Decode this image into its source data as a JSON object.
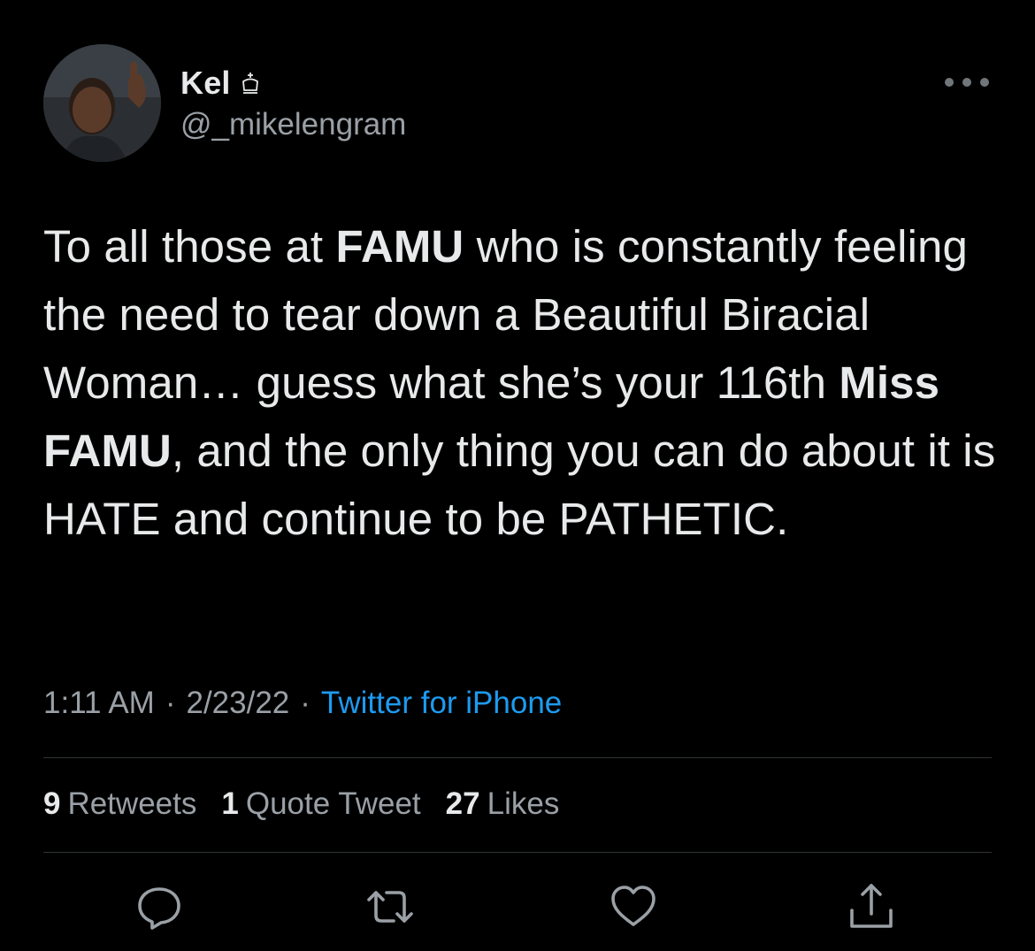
{
  "author": {
    "display_name": "Kel",
    "badge_icon": "crown-icon",
    "handle": "@_mikelengram"
  },
  "tweet": {
    "segments": [
      {
        "text": "To all those at ",
        "bold": false
      },
      {
        "text": "FAMU",
        "bold": true
      },
      {
        "text": " who is constantly feeling the need to tear down a Beautiful Biracial Woman… guess what she’s your 116th ",
        "bold": false
      },
      {
        "text": "Miss FAMU",
        "bold": true
      },
      {
        "text": ", and the only thing you can do about it is HATE and continue to be PATHETIC.",
        "bold": false
      }
    ]
  },
  "meta": {
    "time": "1:11 AM",
    "separator": "·",
    "date": "2/23/22",
    "source": "Twitter for iPhone"
  },
  "stats": {
    "retweets_count": "9",
    "retweets_label": "Retweets",
    "quotes_count": "1",
    "quotes_label": "Quote Tweet",
    "likes_count": "27",
    "likes_label": "Likes"
  },
  "actions": {
    "reply_icon": "reply-icon",
    "retweet_icon": "retweet-icon",
    "like_icon": "heart-icon",
    "share_icon": "share-icon"
  },
  "colors": {
    "background": "#000000",
    "text": "#e7e9ea",
    "muted": "#9aa0a6",
    "link": "#1d9bf0",
    "divider": "#2f3336"
  }
}
